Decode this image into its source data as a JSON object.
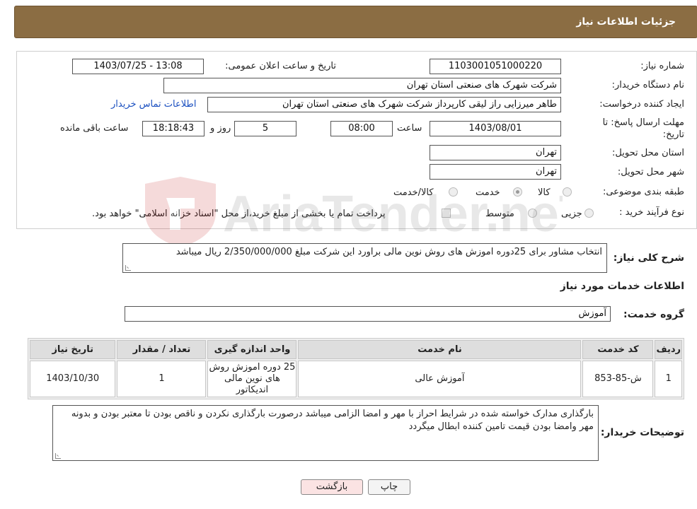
{
  "header": {
    "title": "جزئیات اطلاعات نیاز"
  },
  "fields": {
    "need_number_label": "شماره نیاز:",
    "need_number": "1103001051000220",
    "announce_label": "تاریخ و ساعت اعلان عمومی:",
    "announce_value": "1403/07/25 - 13:08",
    "buyer_org_label": "نام دستگاه خریدار:",
    "buyer_org": "شرکت شهرک های صنعتی استان تهران",
    "creator_label": "ایجاد کننده درخواست:",
    "creator": "طاهر  میرزایی راز لیقی کارپرداز شرکت شهرک های صنعتی استان تهران",
    "contact_link": "اطلاعات تماس خریدار",
    "deadline_label_1": "مهلت ارسال پاسخ: تا",
    "deadline_label_2": "تاریخ:",
    "deadline_date": "1403/08/01",
    "time_label": "ساعت",
    "deadline_time": "08:00",
    "days_value": "5",
    "days_label": "روز و",
    "remaining_time": "18:18:43",
    "remaining_label": "ساعت باقی مانده",
    "province_label": "استان محل تحویل:",
    "province": "تهران",
    "city_label": "شهر محل تحویل:",
    "city": "تهران",
    "category_label": "طبقه بندی موضوعی:",
    "category_options": [
      "کالا",
      "خدمت",
      "کالا/خدمت"
    ],
    "category_selected": "خدمت",
    "process_label": "نوع فرآیند خرید :",
    "process_options": [
      "جزیی",
      "متوسط"
    ],
    "process_note": "پرداخت تمام یا بخشی از مبلغ خرید،از محل \"اسناد خزانه اسلامی\" خواهد بود.",
    "summary_label": "شرح کلی نیاز:",
    "summary": "انتخاب مشاور برای 25دوره اموزش های روش نوین مالی براورد این شرکت مبلغ 2/350/000/000 ریال میباشد"
  },
  "services": {
    "section_title": "اطلاعات خدمات مورد نیاز",
    "group_label": "گروه خدمت:",
    "group_value": "آموزش",
    "columns": [
      "ردیف",
      "کد خدمت",
      "نام خدمت",
      "واحد اندازه گیری",
      "تعداد / مقدار",
      "تاریخ نیاز"
    ],
    "rows": [
      {
        "idx": "1",
        "code": "ش-85-853",
        "name": "آموزش عالی",
        "unit": "25 دوره اموزش روش های نوین مالی اندیکاتور",
        "qty": "1",
        "date": "1403/10/30"
      }
    ]
  },
  "buyer_notes": {
    "label": "توضیحات خریدار:",
    "text": "بارگذاری مدارک خواسته شده در شرایط احراز با مهر و  امضا الزامی میباشد درصورت بارگذاری نکردن و ناقص بودن تا معتبر بودن و بدونه مهر وامضا بودن قیمت تامین کننده ابطال میگردد"
  },
  "buttons": {
    "print": "چاپ",
    "back": "بازگشت"
  },
  "watermark": {
    "text": "AriaTender.neT"
  },
  "colors": {
    "header_bg": "#8b6d43",
    "link": "#1a4fc0",
    "back_button_bg": "#fbe3e3"
  }
}
